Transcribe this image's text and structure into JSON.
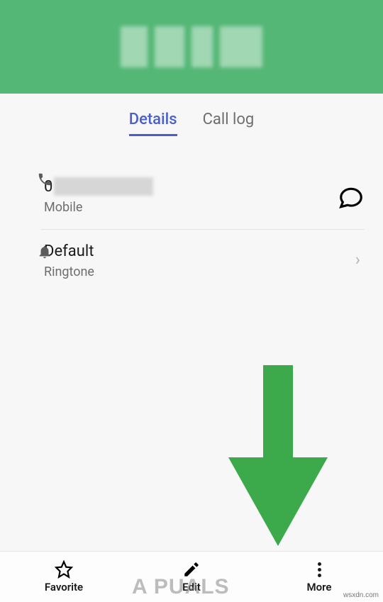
{
  "header": {
    "contact_name": ""
  },
  "tabs": {
    "details": "Details",
    "call_log": "Call log",
    "active": "details"
  },
  "phone": {
    "number_prefix": "0",
    "label": "Mobile"
  },
  "ringtone": {
    "value": "Default",
    "label": "Ringtone"
  },
  "bottom": {
    "favorite": "Favorite",
    "edit": "Edit",
    "more": "More"
  },
  "arrow": {
    "color": "#3caa4b"
  },
  "watermark": {
    "logo": "A   PUALS",
    "source": "wsxdn.com"
  }
}
